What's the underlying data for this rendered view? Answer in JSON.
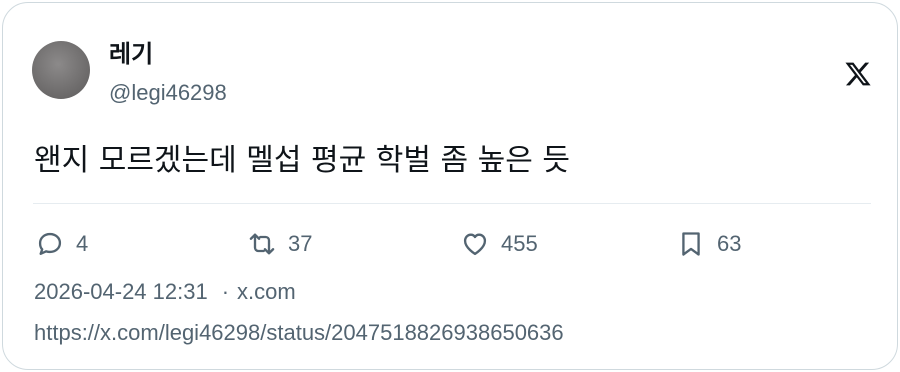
{
  "author": {
    "display_name": "레기",
    "handle": "@legi46298"
  },
  "tweet": {
    "text": "왠지 모르겠는데 멜섭 평균 학벌 좀 높은 듯"
  },
  "actions": {
    "replies": "4",
    "reposts": "37",
    "likes": "455",
    "bookmarks": "63"
  },
  "meta": {
    "timestamp": "2026-04-24 12:31",
    "separator": "·",
    "source": "x.com"
  },
  "url": "https://x.com/legi46298/status/2047518826938650636",
  "icons": {
    "brand": "x-logo-icon",
    "reply": "reply-icon",
    "repost": "repost-icon",
    "like": "heart-icon",
    "bookmark": "bookmark-icon"
  },
  "colors": {
    "text": "#0f1419",
    "muted": "#536471",
    "border": "#cfd9de"
  }
}
